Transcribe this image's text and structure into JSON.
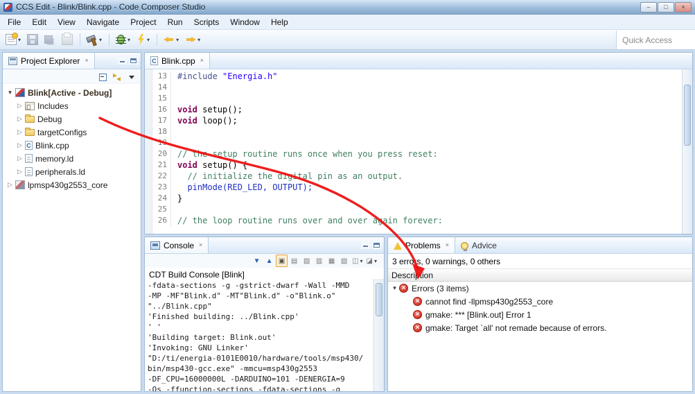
{
  "window": {
    "title": "CCS Edit - Blink/Blink.cpp - Code Composer Studio",
    "controls": [
      {
        "name": "minimize"
      },
      {
        "name": "maximize"
      },
      {
        "name": "close"
      }
    ]
  },
  "menu": {
    "items": [
      "File",
      "Edit",
      "View",
      "Navigate",
      "Project",
      "Run",
      "Scripts",
      "Window",
      "Help"
    ]
  },
  "toolbar": {
    "quick_access": "Quick Access",
    "buttons": [
      {
        "name": "new",
        "dropdown": true
      },
      {
        "name": "save",
        "disabled": true
      },
      {
        "name": "save-all",
        "disabled": true
      },
      {
        "name": "print",
        "disabled": true
      },
      {
        "sep": true
      },
      {
        "name": "build",
        "dropdown": true
      },
      {
        "sep": true
      },
      {
        "name": "debug",
        "dropdown": true
      },
      {
        "name": "flash",
        "dropdown": true
      },
      {
        "sep": true
      },
      {
        "name": "back",
        "dropdown": true
      },
      {
        "name": "forward",
        "dropdown": true
      }
    ]
  },
  "project_explorer": {
    "tab": "Project Explorer",
    "toolbar": [
      {
        "name": "collapse-all"
      },
      {
        "name": "link-with-editor"
      },
      {
        "name": "view-menu"
      }
    ],
    "items": [
      {
        "label": "Blink",
        "suffix": " [Active - Debug]",
        "level": 0,
        "icon": "ccs",
        "arrow": "expanded",
        "bold": true
      },
      {
        "label": "Includes",
        "level": 1,
        "icon": "includes",
        "arrow": "collapsed"
      },
      {
        "label": "Debug",
        "level": 1,
        "icon": "folder",
        "arrow": "collapsed"
      },
      {
        "label": "targetConfigs",
        "level": 1,
        "icon": "folder",
        "arrow": "collapsed"
      },
      {
        "label": "Blink.cpp",
        "level": 1,
        "icon": "cpp",
        "arrow": "collapsed"
      },
      {
        "label": "memory.ld",
        "level": 1,
        "icon": "ld",
        "arrow": "collapsed"
      },
      {
        "label": "peripherals.ld",
        "level": 1,
        "icon": "ld",
        "arrow": "collapsed"
      },
      {
        "label": "lpmsp430g2553_core",
        "level": 0,
        "icon": "ccs-closed",
        "arrow": "collapsed"
      }
    ]
  },
  "editor": {
    "tab": "Blink.cpp",
    "lines": [
      {
        "n": "13",
        "segs": [
          {
            "t": "#include ",
            "c": "pp"
          },
          {
            "t": "\"Energia.h\"",
            "c": "str"
          }
        ]
      },
      {
        "n": "14",
        "segs": []
      },
      {
        "n": "15",
        "segs": []
      },
      {
        "n": "16",
        "segs": [
          {
            "t": "void ",
            "c": "kw"
          },
          {
            "t": "setup();",
            "c": "pl"
          }
        ]
      },
      {
        "n": "17",
        "segs": [
          {
            "t": "void ",
            "c": "kw"
          },
          {
            "t": "loop();",
            "c": "pl"
          }
        ]
      },
      {
        "n": "18",
        "segs": []
      },
      {
        "n": "19",
        "segs": []
      },
      {
        "n": "20",
        "segs": [
          {
            "t": "// the setup routine runs once when you press reset:",
            "c": "com"
          }
        ]
      },
      {
        "n": "21",
        "segs": [
          {
            "t": "void ",
            "c": "kw"
          },
          {
            "t": "setup() {",
            "c": "pl"
          }
        ]
      },
      {
        "n": "22",
        "segs": [
          {
            "t": "  ",
            "c": "pl"
          },
          {
            "t": "// initialize the digital pin as an output.",
            "c": "com"
          }
        ]
      },
      {
        "n": "23",
        "segs": [
          {
            "t": "  ",
            "c": "pl"
          },
          {
            "t": "pinMode(RED_LED, OUTPUT);",
            "c": "fn"
          }
        ]
      },
      {
        "n": "24",
        "segs": [
          {
            "t": "}",
            "c": "pl"
          }
        ]
      },
      {
        "n": "25",
        "segs": []
      },
      {
        "n": "26",
        "segs": [
          {
            "t": "// the loop routine runs over and over again forever:",
            "c": "com"
          }
        ]
      }
    ]
  },
  "console": {
    "tab": "Console",
    "title": "CDT Build Console [Blink]",
    "icons": [
      {
        "name": "next-error-icon",
        "glyph": "▼",
        "color": "#2f62ae"
      },
      {
        "name": "previous-error-icon",
        "glyph": "▲",
        "color": "#2f62ae"
      },
      {
        "name": "show-error-in-editor-icon",
        "glyph": "▣",
        "color": "#555",
        "active": true
      },
      {
        "name": "export-log-icon",
        "glyph": "▤",
        "color": "#777"
      },
      {
        "name": "clear-console-icon",
        "glyph": "▨",
        "color": "#777"
      },
      {
        "name": "scroll-lock-icon",
        "glyph": "▥",
        "color": "#777"
      },
      {
        "name": "word-wrap-icon",
        "glyph": "▦",
        "color": "#777"
      },
      {
        "name": "pin-console-icon",
        "glyph": "▧",
        "color": "#777"
      },
      {
        "name": "display-console-icon",
        "glyph": "◫",
        "color": "#777",
        "dropdown": true
      },
      {
        "name": "open-console-icon",
        "glyph": "◪",
        "color": "#777",
        "dropdown": true
      }
    ],
    "lines": [
      "-fdata-sections -g -gstrict-dwarf -Wall -MMD",
      "-MP -MF\"Blink.d\" -MT\"Blink.d\" -o\"Blink.o\"",
      "\"../Blink.cpp\"",
      "'Finished building: ../Blink.cpp'",
      "' '",
      "'Building target: Blink.out'",
      "'Invoking: GNU Linker'",
      "\"D:/ti/energia-0101E0010/hardware/tools/msp430/",
      "bin/msp430-gcc.exe\" -mmcu=msp430g2553",
      "-DF_CPU=16000000L -DARDUINO=101 -DENERGIA=9",
      "-Os -ffunction-sections -fdata-sections -g"
    ]
  },
  "problems": {
    "tabs": [
      {
        "label": "Problems",
        "selected": true
      },
      {
        "label": "Advice",
        "selected": false
      }
    ],
    "summary": "3 errors, 0 warnings, 0 others",
    "column_header": "Description",
    "group": "Errors (3 items)",
    "items": [
      "cannot find -llpmsp430g2553_core",
      "gmake: *** [Blink.out] Error 1",
      "gmake: Target `all' not remade because of errors."
    ]
  },
  "icons": {
    "close_glyph": "×",
    "dropdown_glyph": "▾",
    "collapsed_glyph": "▷",
    "expanded_glyph": "▾",
    "minimize_glyph": "–",
    "maximize_glyph": "□",
    "close_window_glyph": "×"
  }
}
